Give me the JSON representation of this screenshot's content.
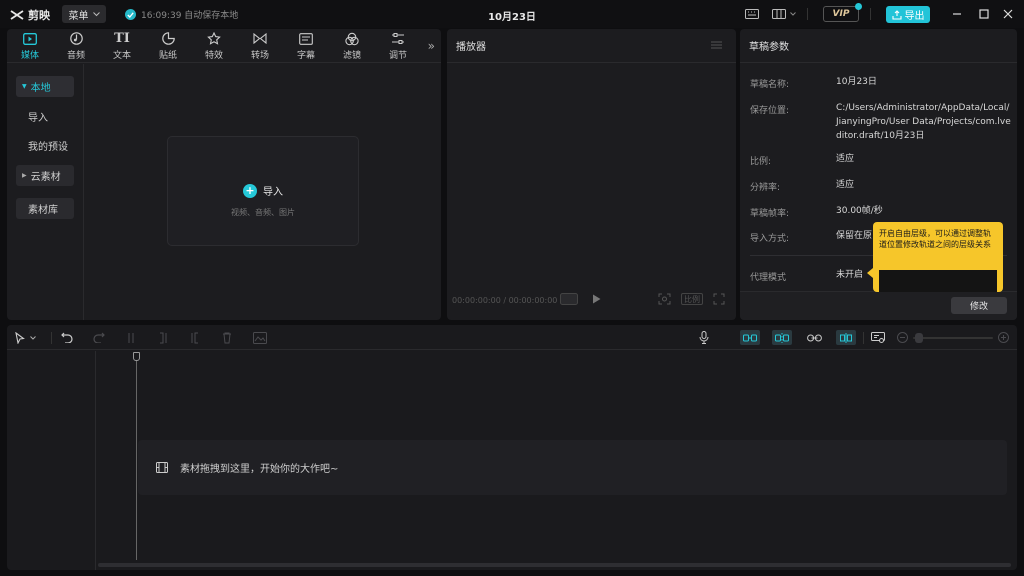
{
  "app": {
    "logo_text": "剪映",
    "menu_label": "菜单",
    "autosave_text": "16:09:39 自动保存本地",
    "title": "10月23日",
    "vip_label": "VIP",
    "export_label": "导出"
  },
  "media": {
    "tabs": [
      {
        "label": "媒体",
        "icon": "media-icon"
      },
      {
        "label": "音频",
        "icon": "audio-icon"
      },
      {
        "label": "文本",
        "icon": "text-icon"
      },
      {
        "label": "贴纸",
        "icon": "sticker-icon"
      },
      {
        "label": "特效",
        "icon": "effects-icon"
      },
      {
        "label": "转场",
        "icon": "transition-icon"
      },
      {
        "label": "字幕",
        "icon": "subtitle-icon"
      },
      {
        "label": "滤镜",
        "icon": "filter-icon"
      },
      {
        "label": "调节",
        "icon": "adjust-icon"
      }
    ],
    "sidebar": {
      "local": "本地",
      "import": "导入",
      "presets": "我的预设",
      "cloud": "云素材",
      "library": "素材库"
    },
    "import_label": "导入",
    "import_hint": "视频、音频、图片"
  },
  "player": {
    "title": "播放器",
    "timecode": "00:00:00:00 / 00:00:00:00",
    "ratio_label": "比例"
  },
  "draft": {
    "title": "草稿参数",
    "fields": [
      {
        "key": "草稿名称:",
        "value": "10月23日"
      },
      {
        "key": "保存位置:",
        "value": "C:/Users/Administrator/AppData/Local/JianyingPro/User Data/Projects/com.lveditor.draft/10月23日"
      },
      {
        "key": "比例:",
        "value": "适应"
      },
      {
        "key": "分辨率:",
        "value": "适应"
      },
      {
        "key": "草稿帧率:",
        "value": "30.00帧/秒"
      },
      {
        "key": "导入方式:",
        "value": "保留在原"
      },
      {
        "key": "代理模式",
        "value": "未开启"
      }
    ],
    "edit_label": "修改",
    "tooltip": "开启自由层级，可以通过调整轨道位置修改轨道之间的层级关系"
  },
  "timeline": {
    "drop_hint": "素材拖拽到这里，开始你的大作吧~"
  },
  "colors": {
    "accent": "#25c8d8",
    "tooltip_bg": "#f6c62a"
  }
}
